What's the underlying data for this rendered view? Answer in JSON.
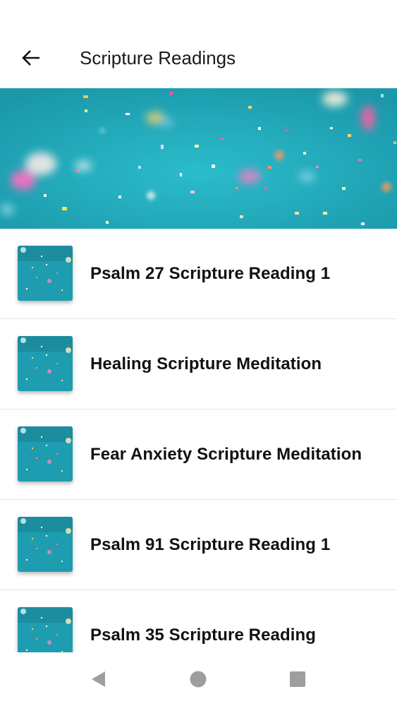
{
  "app_bar": {
    "title": "Scripture Readings",
    "back_icon": "arrow-left-icon"
  },
  "banner": {
    "description_icon": "confetti-image",
    "colors": {
      "background": "#22aabb"
    }
  },
  "list": {
    "items": [
      {
        "title": "Psalm 27 Scripture Reading 1",
        "thumbnail_icon": "confetti-thumbnail"
      },
      {
        "title": "Healing Scripture Meditation",
        "thumbnail_icon": "confetti-thumbnail"
      },
      {
        "title": "Fear Anxiety Scripture Meditation",
        "thumbnail_icon": "confetti-thumbnail"
      },
      {
        "title": "Psalm 91 Scripture Reading 1",
        "thumbnail_icon": "confetti-thumbnail"
      },
      {
        "title": "Psalm 35 Scripture Reading",
        "thumbnail_icon": "confetti-thumbnail"
      }
    ]
  },
  "nav_bar": {
    "back_icon": "triangle-back-icon",
    "home_icon": "circle-home-icon",
    "recents_icon": "square-recents-icon",
    "icon_color": "#9e9e9e"
  }
}
